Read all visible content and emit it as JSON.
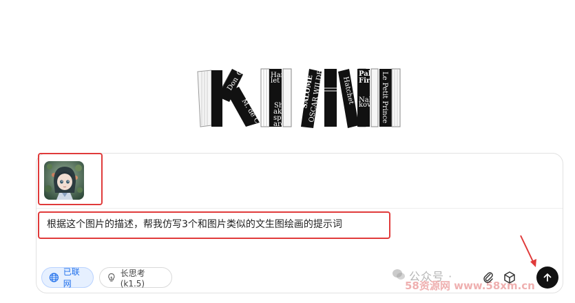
{
  "logo": {
    "spines": {
      "don_quixote": [
        "Don",
        "Quixote"
      ],
      "tie_de_cervantes": "M. de Cervantes",
      "hamlet": [
        "Ham",
        "let"
      ],
      "shakespeare": [
        "Sh",
        "ake",
        "spe",
        "are"
      ],
      "salome": "SALOME",
      "wilde": "OSCAR WILDE",
      "ubik": "Hatchet",
      "pale_fire": [
        "Pale",
        "Fire"
      ],
      "nabokov": [
        "Nabo",
        "kov"
      ],
      "le_petit_prince": "Le Petit Prince"
    }
  },
  "composer": {
    "prompt": "根据这个图片的描述，帮我仿写3个和图片类似的文生图绘画的提示词"
  },
  "toolbar": {
    "web_label": "已联网",
    "think_label": "长思考 (k1.5)"
  },
  "watermark": {
    "line1": "公众号 · ",
    "line2": "58资源网 www.58xm.cn"
  },
  "icons": {
    "globe": "globe-icon",
    "lightbulb": "lightbulb-icon",
    "attach": "paperclip-icon",
    "cube": "cube-icon",
    "send": "arrow-up-icon"
  },
  "colors": {
    "highlight_red": "#e03a3a",
    "web_chip_blue": "#1f6feb",
    "send_black": "#111111"
  }
}
